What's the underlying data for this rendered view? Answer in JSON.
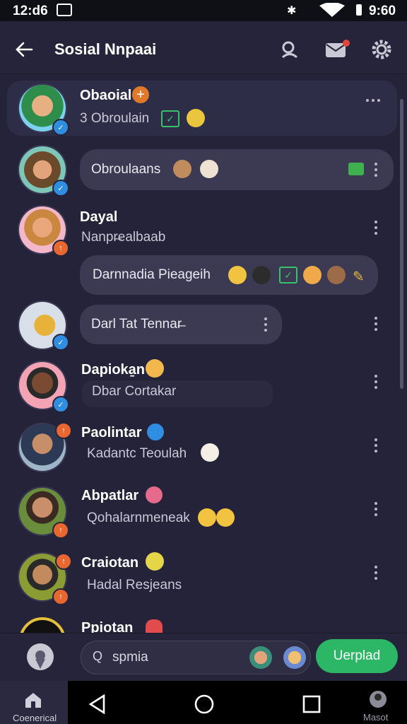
{
  "status_bar": {
    "time": "12:d6",
    "right_text": "9:60"
  },
  "header": {
    "title": "Sosial Nnpaai"
  },
  "contacts": [
    {
      "name": "Obaoial",
      "subtitle": "3 Obroulain"
    },
    {
      "bubble": "Obroulaans"
    },
    {
      "name": "Dayal",
      "subtitle": "Nanpr̶ealbaab",
      "bubble": "Darnnadia Pieageih"
    },
    {
      "bubble": "Darl Tat Tennar̶"
    },
    {
      "name": "Dapioka̱n",
      "subtitle": "Dbar Cortakar"
    },
    {
      "name": "Paolintar",
      "subtitle": "Kadantc Teoulah"
    },
    {
      "name": "Abpatlar",
      "subtitle": "Qohalarnmeneak"
    },
    {
      "name": "Craiotan",
      "subtitle": "Hadal Resjeans"
    },
    {
      "name": "Ppiotan"
    }
  ],
  "search": {
    "placeholder": "spmia"
  },
  "upload_button": {
    "label": "Uerplad"
  },
  "nav": {
    "left_label": "Coenerical",
    "right_label": "Masot"
  },
  "colors": {
    "accent_green": "#2bb765",
    "badge_blue": "#2f8ee0",
    "badge_orange": "#e8662f",
    "background": "#24233a"
  }
}
